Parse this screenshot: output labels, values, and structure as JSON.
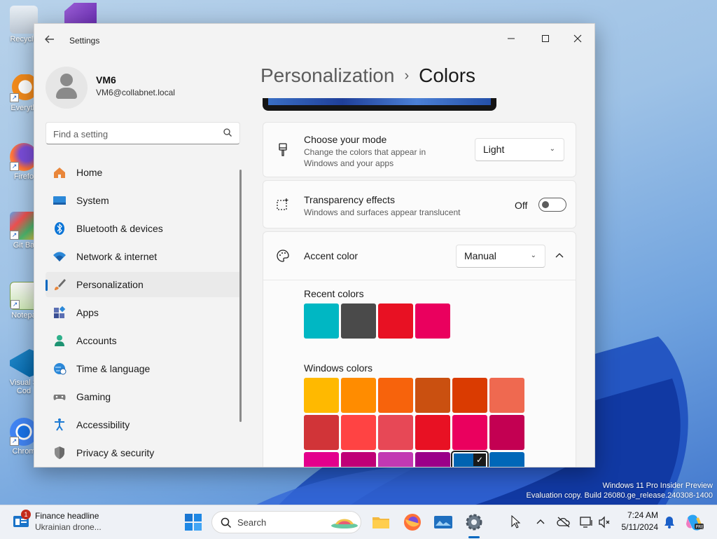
{
  "desktop": {
    "icons": [
      {
        "label": "Recycle"
      },
      {
        "label": "Everyth"
      },
      {
        "label": "Firefo"
      },
      {
        "label": "Git Ba"
      },
      {
        "label": "Notepa"
      },
      {
        "label": "Visual S\nCod"
      },
      {
        "label": "Chrom"
      }
    ],
    "watermark_line1": "Windows 11 Pro Insider Preview",
    "watermark_line2": "Evaluation copy. Build 26080.ge_release.240308-1400"
  },
  "window": {
    "title": "Settings",
    "back_icon": "arrow-left-icon",
    "minimize": "—",
    "maximize": "☐",
    "close": "✕"
  },
  "profile": {
    "name": "VM6",
    "email": "VM6@collabnet.local"
  },
  "search": {
    "placeholder": "Find a setting"
  },
  "nav": {
    "items": [
      {
        "label": "Home",
        "icon": "home-icon"
      },
      {
        "label": "System",
        "icon": "system-icon"
      },
      {
        "label": "Bluetooth & devices",
        "icon": "bluetooth-icon"
      },
      {
        "label": "Network & internet",
        "icon": "wifi-icon"
      },
      {
        "label": "Personalization",
        "icon": "brush-icon",
        "selected": true
      },
      {
        "label": "Apps",
        "icon": "apps-icon"
      },
      {
        "label": "Accounts",
        "icon": "accounts-icon"
      },
      {
        "label": "Time & language",
        "icon": "globe-icon"
      },
      {
        "label": "Gaming",
        "icon": "gamepad-icon"
      },
      {
        "label": "Accessibility",
        "icon": "accessibility-icon"
      },
      {
        "label": "Privacy & security",
        "icon": "shield-icon"
      }
    ]
  },
  "breadcrumb": {
    "parent": "Personalization",
    "separator": "›",
    "current": "Colors"
  },
  "mode": {
    "title": "Choose your mode",
    "subtitle": "Change the colors that appear in Windows and your apps",
    "value": "Light"
  },
  "transparency": {
    "title": "Transparency effects",
    "subtitle": "Windows and surfaces appear translucent",
    "state": "Off"
  },
  "accent": {
    "title": "Accent color",
    "value": "Manual",
    "recent_label": "Recent colors",
    "recent_colors": [
      "#00b7c3",
      "#4a4a4a",
      "#e81123",
      "#ea005e"
    ],
    "windows_label": "Windows colors",
    "windows_colors": [
      [
        "#ffb900",
        "#ff8c00",
        "#f7630c",
        "#ca5010",
        "#da3b01",
        "#ef6950"
      ],
      [
        "#d13438",
        "#ff4343",
        "#e74856",
        "#e81123",
        "#ea005e",
        "#c30052"
      ],
      [
        "#e3008c",
        "#bf0077",
        "#c239b3",
        "#9a0089",
        "#0063b1",
        "#0067b8"
      ]
    ],
    "selected_color": "#0063b1"
  },
  "taskbar": {
    "news_badge": "1",
    "news_title": "Finance headline",
    "news_sub": "Ukrainian drone...",
    "search_label": "Search",
    "time": "7:24 AM",
    "date": "5/11/2024"
  }
}
